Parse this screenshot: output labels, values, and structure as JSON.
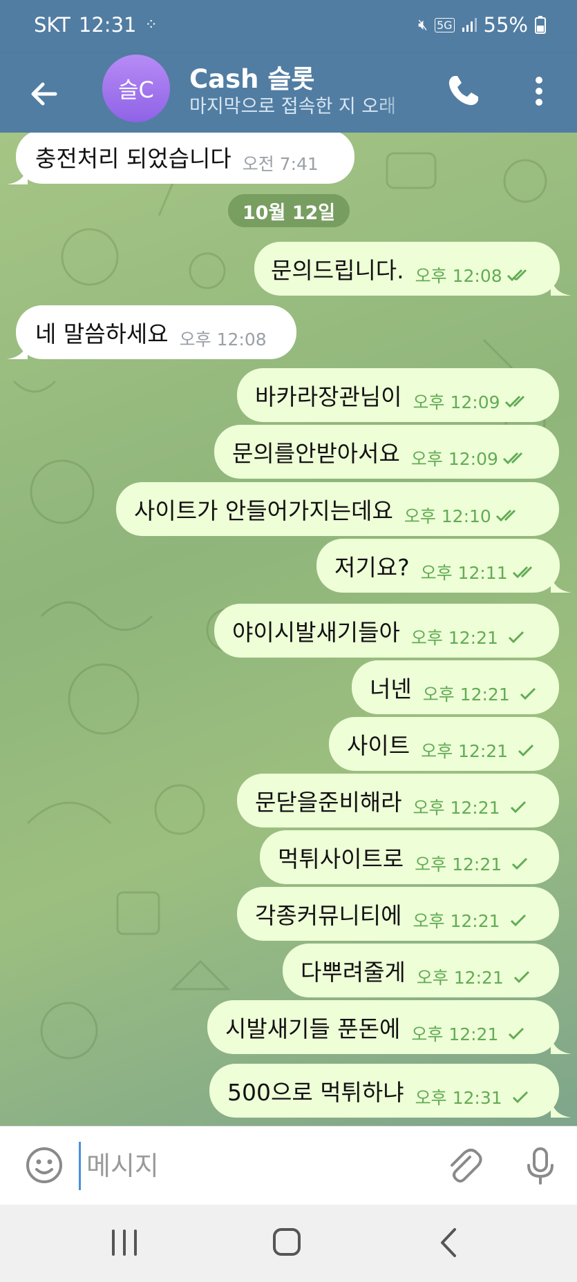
{
  "status_bar": {
    "carrier": "SKT",
    "time": "12:31",
    "network": "5G",
    "battery": "55%"
  },
  "header": {
    "avatar_text": "슬C",
    "title": "Cash 슬롯",
    "subtitle": "마지막으로 접속한 지 오래"
  },
  "chat": {
    "date_separator": "10월 12일",
    "messages": [
      {
        "dir": "in",
        "text": "충전처리 되었습니다",
        "time": "오전 7:41"
      },
      {
        "dir": "out",
        "text": "문의드립니다.",
        "time": "오후 12:08",
        "status": "read"
      },
      {
        "dir": "in",
        "text": "네 말씀하세요",
        "time": "오후 12:08"
      },
      {
        "dir": "out",
        "text": "바카라장관님이",
        "time": "오후 12:09",
        "status": "read"
      },
      {
        "dir": "out",
        "text": "문의를안받아서요",
        "time": "오후 12:09",
        "status": "read"
      },
      {
        "dir": "out",
        "text": "사이트가 안들어가지는데요",
        "time": "오후 12:10",
        "status": "read"
      },
      {
        "dir": "out",
        "text": "저기요?",
        "time": "오후 12:11",
        "status": "read"
      },
      {
        "dir": "out",
        "text": "야이시발새기들아",
        "time": "오후 12:21",
        "status": "sent"
      },
      {
        "dir": "out",
        "text": "너넨",
        "time": "오후 12:21",
        "status": "sent"
      },
      {
        "dir": "out",
        "text": "사이트",
        "time": "오후 12:21",
        "status": "sent"
      },
      {
        "dir": "out",
        "text": "문닫을준비해라",
        "time": "오후 12:21",
        "status": "sent"
      },
      {
        "dir": "out",
        "text": "먹튀사이트로",
        "time": "오후 12:21",
        "status": "sent"
      },
      {
        "dir": "out",
        "text": "각종커뮤니티에",
        "time": "오후 12:21",
        "status": "sent"
      },
      {
        "dir": "out",
        "text": "다뿌려줄게",
        "time": "오후 12:21",
        "status": "sent"
      },
      {
        "dir": "out",
        "text": "시발새기들 푼돈에",
        "time": "오후 12:21",
        "status": "sent"
      },
      {
        "dir": "out",
        "text": "500으로 먹튀하냐",
        "time": "오후 12:31",
        "status": "sent"
      }
    ]
  },
  "input": {
    "placeholder": "메시지",
    "value": ""
  },
  "icons": {
    "back": "arrow-left-icon",
    "call": "phone-icon",
    "menu": "more-vertical-icon",
    "emoji": "emoji-icon",
    "attach": "paperclip-icon",
    "mic": "microphone-icon",
    "read": "double-check-icon",
    "sent": "single-check-icon"
  },
  "colors": {
    "header": "#517da2",
    "outgoing_bubble": "#eefed7",
    "incoming_bubble": "#ffffff",
    "check": "#62ac55",
    "avatar": "#a277ef"
  }
}
